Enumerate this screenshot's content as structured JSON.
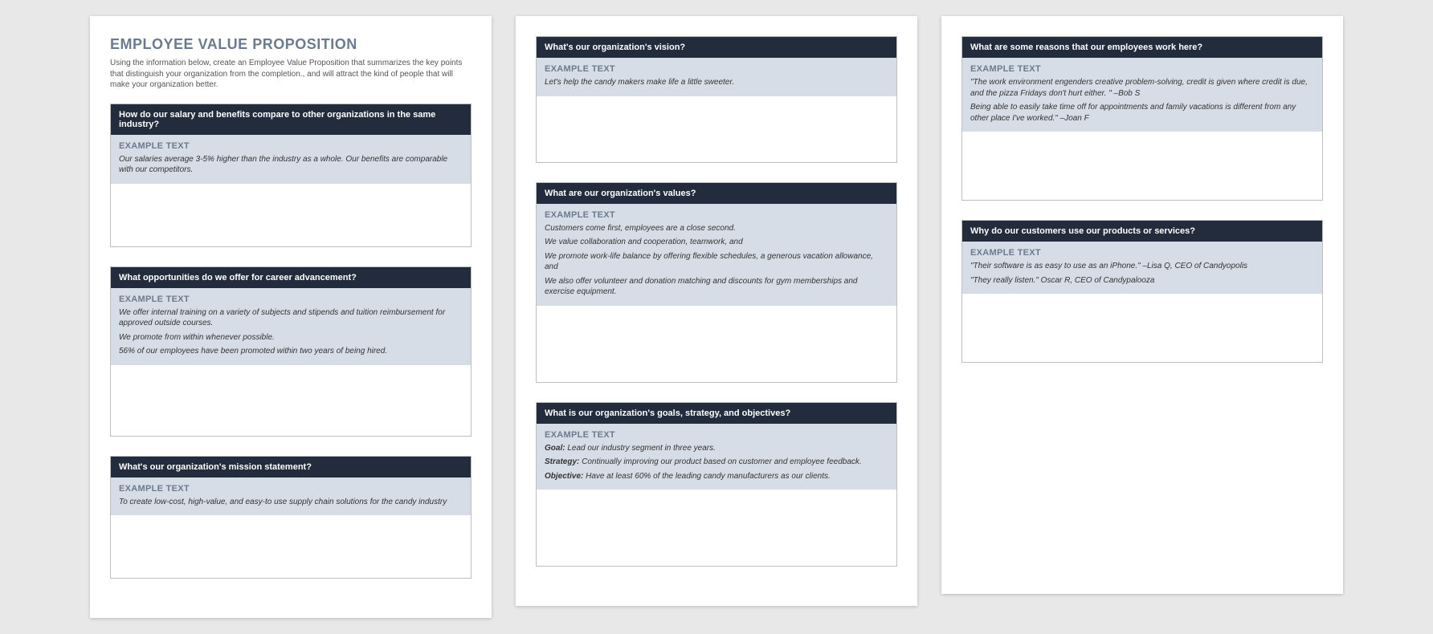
{
  "title": "EMPLOYEE VALUE PROPOSITION",
  "intro": "Using the information below, create an Employee Value Proposition that summarizes the key points that distinguish your organization from the completion., and will attract the kind of people that will make your organization better.",
  "example_label": "EXAMPLE TEXT",
  "sections": {
    "salary": {
      "heading": "How do our salary and benefits compare to other organizations in the same industry?",
      "lines": [
        "Our salaries average 3-5% higher than the industry as a whole. Our benefits are comparable with our competitors."
      ]
    },
    "career": {
      "heading": "What opportunities do we offer for career advancement?",
      "lines": [
        "We offer internal training on a variety of subjects and stipends and tuition reimbursement for approved outside courses.",
        "We promote from within whenever possible.",
        "56% of our employees have been promoted within two years of being hired."
      ]
    },
    "mission": {
      "heading": "What's our organization's mission statement?",
      "lines": [
        "To create low-cost, high-value, and easy-to use supply chain solutions for the candy industry"
      ]
    },
    "vision": {
      "heading": "What's our organization's vision?",
      "lines": [
        "Let's help the candy makers make life a little sweeter."
      ]
    },
    "values": {
      "heading": "What are our organization's values?",
      "lines": [
        "Customers come first, employees are a close second.",
        "We value collaboration and cooperation, teamwork, and",
        "We promote work-life balance by offering flexible schedules, a generous vacation allowance, and",
        "We also offer volunteer and donation matching and discounts for gym memberships and exercise equipment."
      ]
    },
    "goals": {
      "heading": "What is our organization's goals, strategy, and objectives?",
      "kv": [
        {
          "label": "Goal:",
          "text": " Lead our industry segment in three years."
        },
        {
          "label": "Strategy:",
          "text": " Continually improving our product based on customer and employee feedback."
        },
        {
          "label": "Objective:",
          "text": " Have at least 60% of the leading candy manufacturers as our clients."
        }
      ]
    },
    "reasons": {
      "heading": "What are some reasons that our employees work here?",
      "lines": [
        "\"The work environment engenders creative problem-solving, credit is given where credit is due, and the pizza Fridays don't hurt either. \" –Bob S",
        "Being able to easily take time off for appointments and family vacations is different from any other place I've worked.\" –Joan F"
      ]
    },
    "customers": {
      "heading": "Why do our customers use our products or services?",
      "lines": [
        "\"Their software is as easy to use as an iPhone.\" –Lisa Q, CEO of Candyopolis",
        "\"They really listen.\" Oscar R, CEO of Candypalooza"
      ]
    }
  }
}
